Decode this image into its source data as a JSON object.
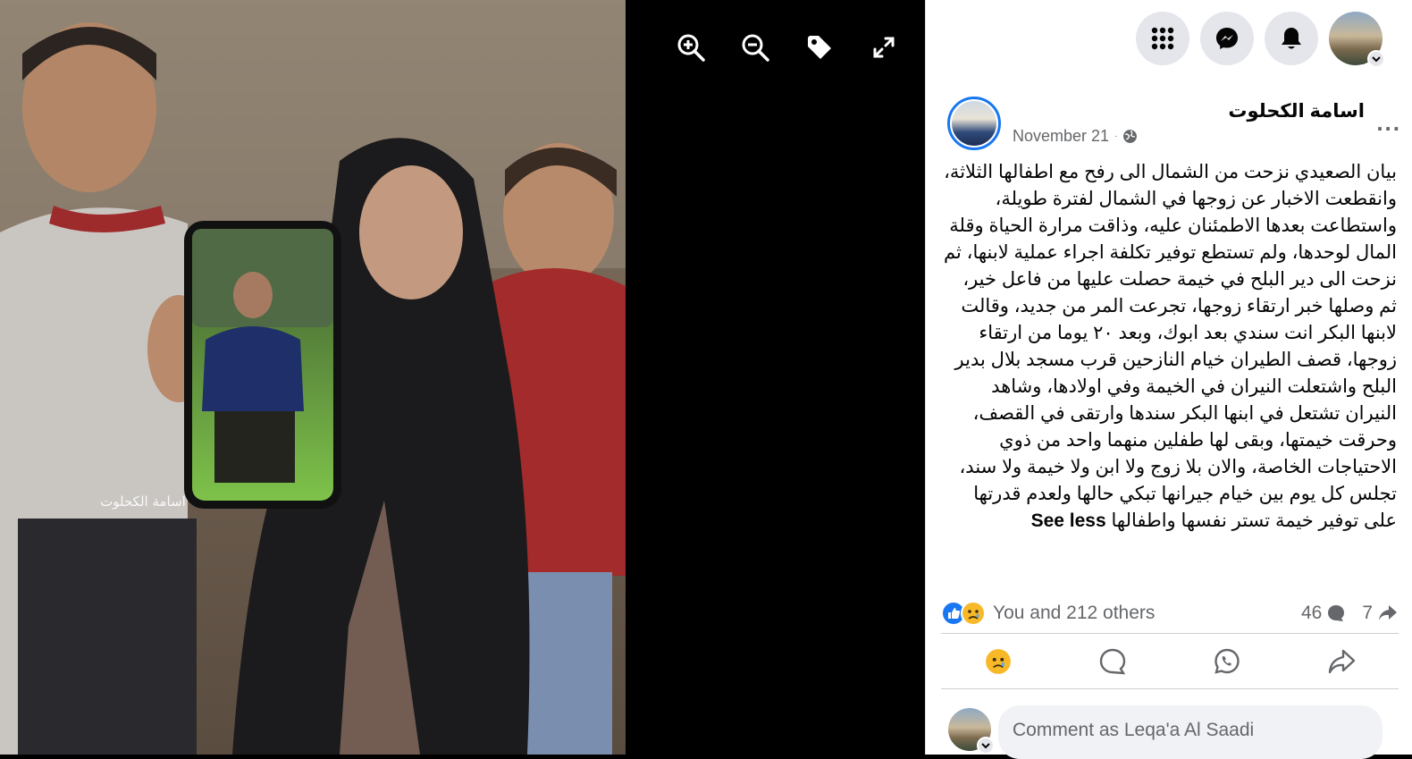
{
  "viewer": {
    "toolbar": [
      "zoom-in-icon",
      "zoom-out-icon",
      "tag-icon",
      "fullscreen-icon"
    ],
    "photo_watermark": "اسامة الكحلوت"
  },
  "topbar": {
    "icons": [
      "menu-grid-icon",
      "messenger-icon",
      "notifications-icon"
    ]
  },
  "post": {
    "author": "اسامة الكحلوت",
    "date": "November 21",
    "more": "...",
    "text": "بيان الصعيدي نزحت من الشمال الى رفح مع اطفالها الثلاثة، وانقطعت الاخبار عن زوجها في الشمال لفترة طويلة، واستطاعت بعدها الاطمئنان عليه، وذاقت مرارة الحياة وقلة المال لوحدها، ولم تستطع توفير تكلفة اجراء عملية لابنها، ثم نزحت الى دير البلح في خيمة حصلت عليها من فاعل خير، ثم وصلها خبر ارتقاء زوجها، تجرعت المر من جديد، وقالت لابنها البكر انت سندي بعد ابوك، وبعد ٢٠ يوما من ارتقاء زوجها، قصف الطيران خيام النازحين قرب مسجد بلال بدير البلح واشتعلت النيران في الخيمة وفي اولادها، وشاهد النيران تشتعل في ابنها البكر سندها وارتقى في القصف، وحرقت خيمتها، وبقى لها طفلين منهما واحد من ذوي الاحتياجات الخاصة، والان بلا زوج ولا ابن ولا خيمة ولا سند، تجلس كل يوم بين خيام جيرانها تبكي حالها ولعدم قدرتها على توفير خيمة تستر نفسها واطفالها",
    "see_less": "See less",
    "reactions_text": "You and 212 others",
    "comments_count": "46",
    "shares_count": "7"
  },
  "comment": {
    "placeholder": "Comment as Leqa'a Al Saadi"
  },
  "colors": {
    "accent": "#1877f2",
    "text": "#050505",
    "secondary": "#65676b"
  }
}
